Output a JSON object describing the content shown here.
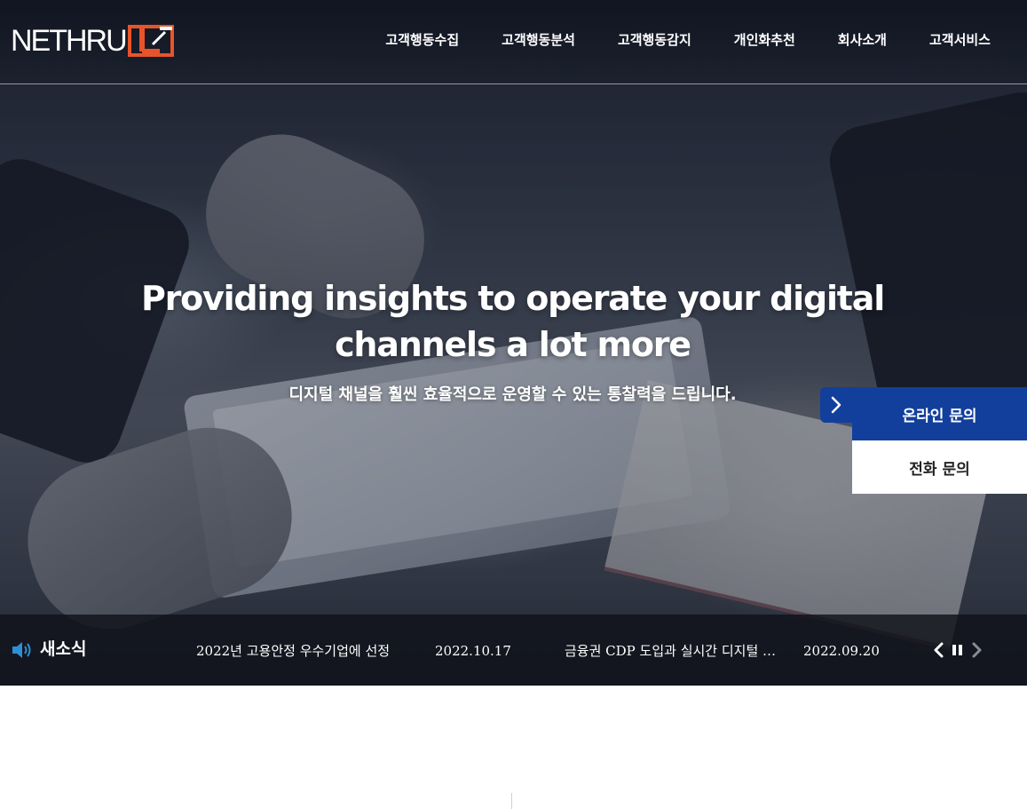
{
  "header": {
    "logo_text": "NETHRU",
    "nav": [
      {
        "label": "고객행동수집"
      },
      {
        "label": "고객행동분석"
      },
      {
        "label": "고객행동감지"
      },
      {
        "label": "개인화추천"
      },
      {
        "label": "회사소개"
      },
      {
        "label": "고객서비스"
      }
    ]
  },
  "hero": {
    "headline_line1": "Providing insights to operate your digital",
    "headline_line2": "channels a lot more",
    "subhead": "디지털 채널을 훨씬 효율적으로 운영할 수 있는 통찰력을 드립니다."
  },
  "inquiry": {
    "online_label": "온라인 문의",
    "phone_label": "전화 문의"
  },
  "news": {
    "title": "새소식",
    "items": [
      {
        "text": "2022년 고용안정 우수기업에 선정",
        "date": "2022.10.17"
      },
      {
        "text": "금융권 CDP 도입과 실시간 디지털 …",
        "date": "2022.09.20"
      }
    ]
  },
  "colors": {
    "accent_blue": "#123f9c",
    "logo_orange": "#e8542a",
    "news_icon_blue": "#2e8fd6"
  },
  "icons": [
    "logo-mark-icon",
    "chevron-right-icon",
    "speaker-icon",
    "prev-arrow-icon",
    "pause-icon",
    "next-arrow-icon"
  ]
}
